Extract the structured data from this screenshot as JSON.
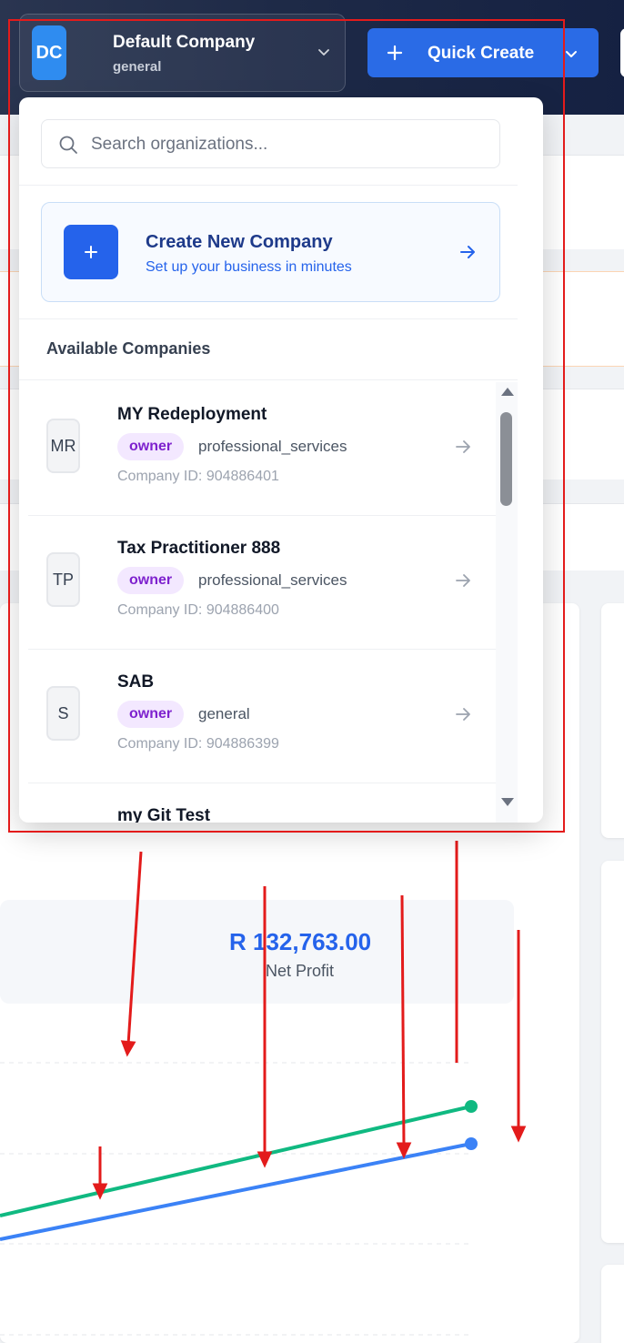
{
  "header": {
    "company": {
      "initials": "DC",
      "name": "Default Company",
      "type": "general"
    },
    "quick_create": {
      "label": "Quick Create"
    },
    "accent": "#2a6be6"
  },
  "dropdown": {
    "search": {
      "placeholder": "Search organizations...",
      "value": ""
    },
    "create": {
      "title": "Create New Company",
      "subtitle": "Set up your business in minutes"
    },
    "section_heading": "Available Companies",
    "companies": [
      {
        "initials": "MR",
        "name": "MY Redeployment",
        "role": "owner",
        "industry": "professional_services",
        "id_text": "Company ID: 904886401"
      },
      {
        "initials": "TP",
        "name": "Tax Practitioner 888",
        "role": "owner",
        "industry": "professional_services",
        "id_text": "Company ID: 904886400"
      },
      {
        "initials": "S",
        "name": "SAB",
        "role": "owner",
        "industry": "general",
        "id_text": "Company ID: 904886399"
      },
      {
        "initials": "",
        "name": "my Git Test",
        "role": "",
        "industry": "",
        "id_text": ""
      }
    ]
  },
  "background": {
    "net_profit_value": "R 132,763.00",
    "net_profit_label": "Net Profit",
    "series_colors": {
      "green": "#10b981",
      "blue": "#3b82f6"
    },
    "annotation_color": "#e31b1b"
  }
}
